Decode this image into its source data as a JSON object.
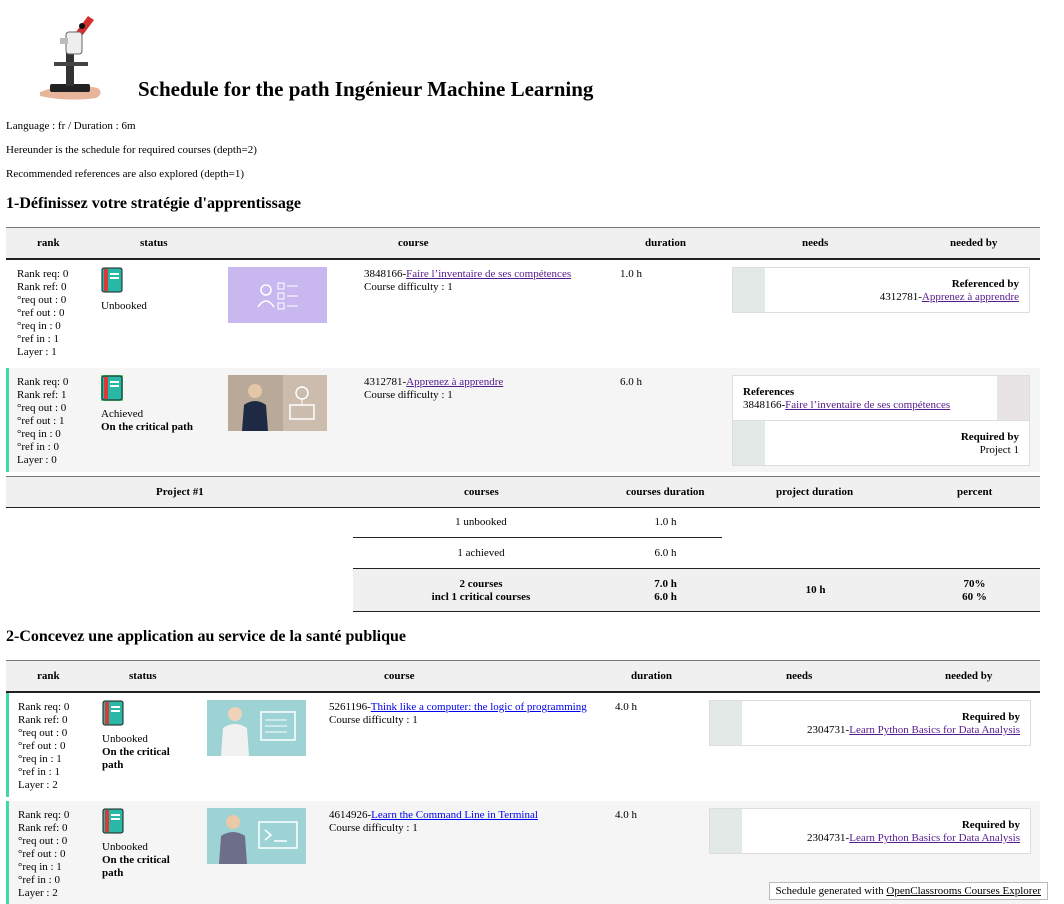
{
  "page": {
    "title": "Schedule for the path Ingénieur Machine Learning",
    "meta_language": "Language : fr / Duration : 6m",
    "meta_required": "Hereunder is the schedule for required courses (depth=2)",
    "meta_recommended": "Recommended references are also explored (depth=1)"
  },
  "headers": {
    "rank": "rank",
    "status": "status",
    "course": "course",
    "duration": "duration",
    "needs": "needs",
    "needed_by": "needed by"
  },
  "sections": [
    {
      "title": "1-Définissez votre stratégie d'apprentissage",
      "courses": [
        {
          "rank": [
            "Rank req: 0",
            "Rank ref: 0",
            "°req out : 0",
            "°ref out : 0",
            "°req in : 0",
            "°ref in : 1",
            "Layer : 1"
          ],
          "status": "Unbooked",
          "critical": "",
          "id": "3848166-",
          "link": "Faire l’inventaire de ses compétences",
          "difficulty": "Course difficulty : 1",
          "duration": "1.0 h",
          "needs_label": "Referenced by",
          "needs_id": "4312781-",
          "needs_link": "Apprenez à apprendre"
        },
        {
          "rank": [
            "Rank req: 0",
            "Rank ref: 1",
            "°req out : 0",
            "°ref out : 1",
            "°req in : 0",
            "°ref in : 0",
            "Layer : 0"
          ],
          "status": "Achieved",
          "critical": "On the critical path",
          "id": "4312781-",
          "link": "Apprenez à apprendre",
          "difficulty": "Course difficulty : 1",
          "duration": "6.0 h",
          "refs_label": "References",
          "refs_id": "3848166-",
          "refs_link": "Faire l’inventaire de ses compétences",
          "needs_label": "Required by",
          "needs_value": "Project 1"
        }
      ],
      "project": {
        "head": "Project #1",
        "courses": "courses",
        "courses_duration": "courses duration",
        "project_duration": "project duration",
        "percent": "percent",
        "rows": [
          {
            "label": "1 unbooked",
            "duration": "1.0 h"
          },
          {
            "label": "1 achieved",
            "duration": "6.0 h"
          }
        ],
        "total_courses": "2 courses",
        "total_critical": "incl 1 critical courses",
        "total_duration": "7.0 h",
        "critical_duration": "6.0 h",
        "project_duration_value": "10 h",
        "percent_total": "70%",
        "percent_critical": "60 %"
      }
    },
    {
      "title": "2-Concevez une application au service de la santé publique",
      "courses": [
        {
          "rank": [
            "Rank req: 0",
            "Rank ref: 0",
            "°req out : 0",
            "°ref out : 0",
            "°req in : 1",
            "°ref in : 1",
            "Layer : 2"
          ],
          "status": "Unbooked",
          "critical": "On the critical path",
          "id": "5261196-",
          "link": "Think like a computer: the logic of programming",
          "difficulty": "Course difficulty : 1",
          "duration": "4.0 h",
          "needs_label": "Required by",
          "needs_id": "2304731-",
          "needs_link": "Learn Python Basics for Data Analysis"
        },
        {
          "rank": [
            "Rank req: 0",
            "Rank ref: 0",
            "°req out : 0",
            "°ref out : 0",
            "°req in : 1",
            "°ref in : 0",
            "Layer : 2"
          ],
          "status": "Unbooked",
          "critical": "On the critical path",
          "id": "4614926-",
          "link": "Learn the Command Line in Terminal",
          "difficulty": "Course difficulty : 1",
          "duration": "4.0 h",
          "needs_label": "Required by",
          "needs_id": "2304731-",
          "needs_link": "Learn Python Basics for Data Analysis"
        }
      ]
    }
  ],
  "footer": {
    "text": "Schedule generated with ",
    "link": "OpenClassrooms Courses Explorer"
  }
}
